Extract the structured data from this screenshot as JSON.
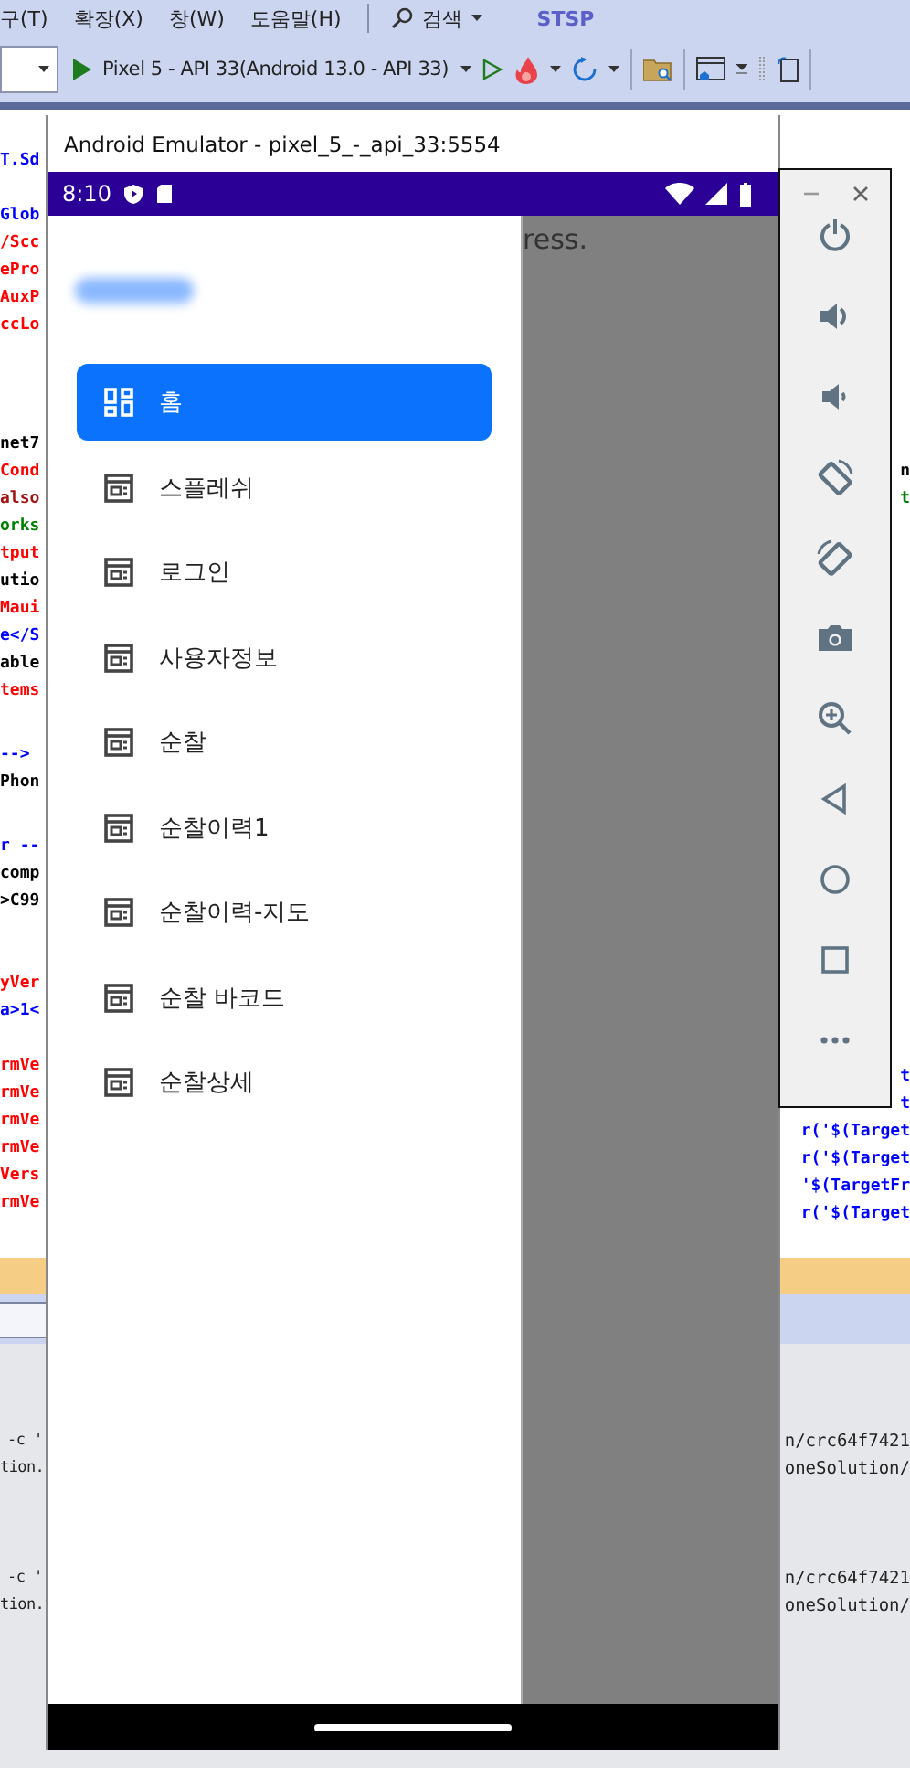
{
  "ide": {
    "menu": [
      {
        "label": "구(T)"
      },
      {
        "label": "확장(X)"
      },
      {
        "label": "창(W)"
      },
      {
        "label": "도움말(H)"
      }
    ],
    "search": {
      "label": "검색"
    },
    "solution_name": "STSP",
    "toolbar": {
      "target": "Pixel 5 - API 33(Android 13.0 - API 33)"
    },
    "code_left": [
      [
        {
          "text": "T.Sd",
          "color": "#0000ff"
        }
      ],
      [
        {
          "text": "Glob",
          "color": "#0000ff"
        },
        {
          "text": "/Scc",
          "color": "#ff0000"
        },
        {
          "text": "ePro",
          "color": "#ff0000"
        },
        {
          "text": "AuxP",
          "color": "#ff0000"
        },
        {
          "text": "ccLo",
          "color": "#ff0000"
        }
      ],
      [
        {
          "text": "net7",
          "color": "#000000"
        },
        {
          "text": "Cond",
          "color": "#ff0000"
        },
        {
          "text": "also",
          "color": "#a31515"
        },
        {
          "text": "orks",
          "color": "#008000"
        },
        {
          "text": "tput",
          "color": "#ff0000"
        },
        {
          "text": "utio",
          "color": "#000000"
        },
        {
          "text": "Maui",
          "color": "#ff0000"
        },
        {
          "text": "e</S",
          "color": "#0000ff"
        },
        {
          "text": "able",
          "color": "#000000"
        },
        {
          "text": "tems",
          "color": "#ff0000"
        }
      ],
      [
        {
          "text": "-->",
          "color": "#0000ff"
        },
        {
          "text": "Phon",
          "color": "#000000"
        }
      ],
      [
        {
          "text": "r --",
          "color": "#0000ff"
        },
        {
          "text": "comp",
          "color": "#000000"
        },
        {
          "text": ">C99",
          "color": "#000000"
        }
      ],
      [
        {
          "text": "yVer",
          "color": "#ff0000"
        },
        {
          "text": "a>1<",
          "color": "#0000ff"
        }
      ],
      [
        {
          "text": "rmVe",
          "color": "#ff0000"
        },
        {
          "text": "rmVe",
          "color": "#ff0000"
        },
        {
          "text": "rmVe",
          "color": "#ff0000"
        },
        {
          "text": "rmVe",
          "color": "#ff0000"
        },
        {
          "text": "Vers",
          "color": "#ff0000"
        },
        {
          "text": "rmVe",
          "color": "#ff0000"
        }
      ]
    ],
    "code_right": [
      [
        {
          "text": "n",
          "color": "#000000"
        },
        {
          "text": "t",
          "color": "#008000"
        }
      ],
      [
        {
          "text": "t",
          "color": "#0000ff"
        },
        {
          "text": "t",
          "color": "#0000ff"
        },
        {
          "text": "r('$(Target",
          "color": "#0000ff"
        },
        {
          "text": "r('$(Target",
          "color": "#0000ff"
        },
        {
          "text": "'$(TargetFr",
          "color": "#0000ff"
        },
        {
          "text": "r('$(Target",
          "color": "#0000ff"
        }
      ]
    ],
    "output_left": [
      [
        "-c '",
        "tion."
      ],
      [
        "-c '",
        "tion."
      ]
    ],
    "output_right": [
      [
        "n/crc64f7421",
        "oneSolution/"
      ],
      [
        "n/crc64f7421",
        "oneSolution/"
      ]
    ]
  },
  "emulator": {
    "title": "Android Emulator - pixel_5_-_api_33:5554",
    "time": "8:10",
    "behind_text": "ress.",
    "drawer_items": [
      {
        "label": "홈",
        "kind": "dashboard",
        "selected": true
      },
      {
        "label": "스플레쉬",
        "kind": "page",
        "selected": false
      },
      {
        "label": "로그인",
        "kind": "page",
        "selected": false
      },
      {
        "label": "사용자정보",
        "kind": "page",
        "selected": false
      },
      {
        "label": "순찰",
        "kind": "page",
        "selected": false
      },
      {
        "label": "순찰이력1",
        "kind": "page",
        "selected": false
      },
      {
        "label": "순찰이력-지도",
        "kind": "page",
        "selected": false
      },
      {
        "label": "순찰 바코드",
        "kind": "page",
        "selected": false
      },
      {
        "label": "순찰상세",
        "kind": "page",
        "selected": false
      }
    ]
  }
}
